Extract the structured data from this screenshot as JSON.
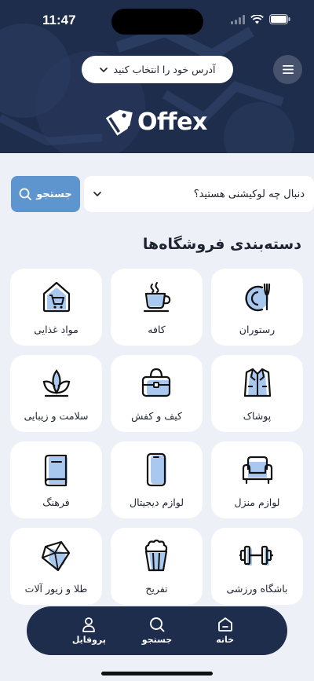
{
  "status": {
    "time": "11:47"
  },
  "header": {
    "address_placeholder": "آدرس خود را انتخاب کنید",
    "logo_text": "Offex"
  },
  "search": {
    "placeholder": "دنبال چه لوکیشنی هستید؟",
    "button_label": "جستجو"
  },
  "categories": {
    "title": "دسته‌بندی فروشگاه‌ها",
    "items": [
      {
        "label": "رستوران",
        "icon": "restaurant-icon"
      },
      {
        "label": "کافه",
        "icon": "coffee-cup-icon"
      },
      {
        "label": "مواد غذایی",
        "icon": "grocery-store-icon"
      },
      {
        "label": "پوشاک",
        "icon": "clothing-icon"
      },
      {
        "label": "کیف و کفش",
        "icon": "bag-icon"
      },
      {
        "label": "سلامت و زیبایی",
        "icon": "lotus-icon"
      },
      {
        "label": "لوازم منزل",
        "icon": "armchair-icon"
      },
      {
        "label": "لوازم دیجیتال",
        "icon": "smartphone-icon"
      },
      {
        "label": "فرهنگ",
        "icon": "book-icon"
      },
      {
        "label": "باشگاه ورزشی",
        "icon": "dumbbell-icon"
      },
      {
        "label": "تفریح",
        "icon": "popcorn-icon"
      },
      {
        "label": "طلا و زیور آلات",
        "icon": "diamond-icon"
      }
    ]
  },
  "bottom_nav": {
    "items": [
      {
        "label": "خانه",
        "icon": "home-icon"
      },
      {
        "label": "جستجو",
        "icon": "search-icon"
      },
      {
        "label": "پروفایل",
        "icon": "user-icon"
      }
    ]
  },
  "colors": {
    "header_bg": "#1f2d4d",
    "page_bg": "#eef0f7",
    "accent": "#5f95cf",
    "icon_fill": "#a9c8f0"
  }
}
